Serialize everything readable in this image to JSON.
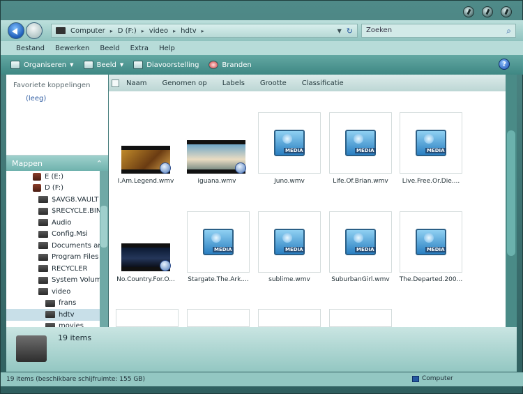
{
  "address": {
    "crumbs": [
      "Computer",
      "D (F:)",
      "video",
      "hdtv"
    ],
    "search_placeholder": "Zoeken"
  },
  "menu": [
    "Bestand",
    "Bewerken",
    "Beeld",
    "Extra",
    "Help"
  ],
  "toolbar": {
    "organize": "Organiseren",
    "view": "Beeld",
    "slideshow": "Diavoorstelling",
    "burn": "Branden"
  },
  "left": {
    "favorites_title": "Favoriete koppelingen",
    "favorites_empty": "(leeg)",
    "folders_title": "Mappen",
    "tree": [
      "E (E:)",
      "D (F:)",
      "$AVG8.VAULT",
      "$RECYCLE.BIN",
      "Audio",
      "Config.Msi",
      "Documents an",
      "Program Files",
      "RECYCLER",
      "System Volume",
      "video",
      "frans",
      "hdtv",
      "movies"
    ]
  },
  "columns": [
    "Naam",
    "Genomen op",
    "Labels",
    "Grootte",
    "Classificatie"
  ],
  "files": [
    "I.Am.Legend.wmv",
    "iguana.wmv",
    "Juno.wmv",
    "Life.Of.Brian.wmv",
    "Live.Free.Or.Die....",
    "No.Country.For.O...",
    "Stargate.The.Ark....",
    "sublime.wmv",
    "SuburbanGirl.wmv",
    "The.Departed.200..."
  ],
  "details": {
    "count": "19 items"
  },
  "status": {
    "left": "19 items (beschikbare schijfruimte: 155 GB)",
    "right": "Computer"
  },
  "colors": {
    "window": "#4f8a88",
    "accent": "#2456a0"
  }
}
